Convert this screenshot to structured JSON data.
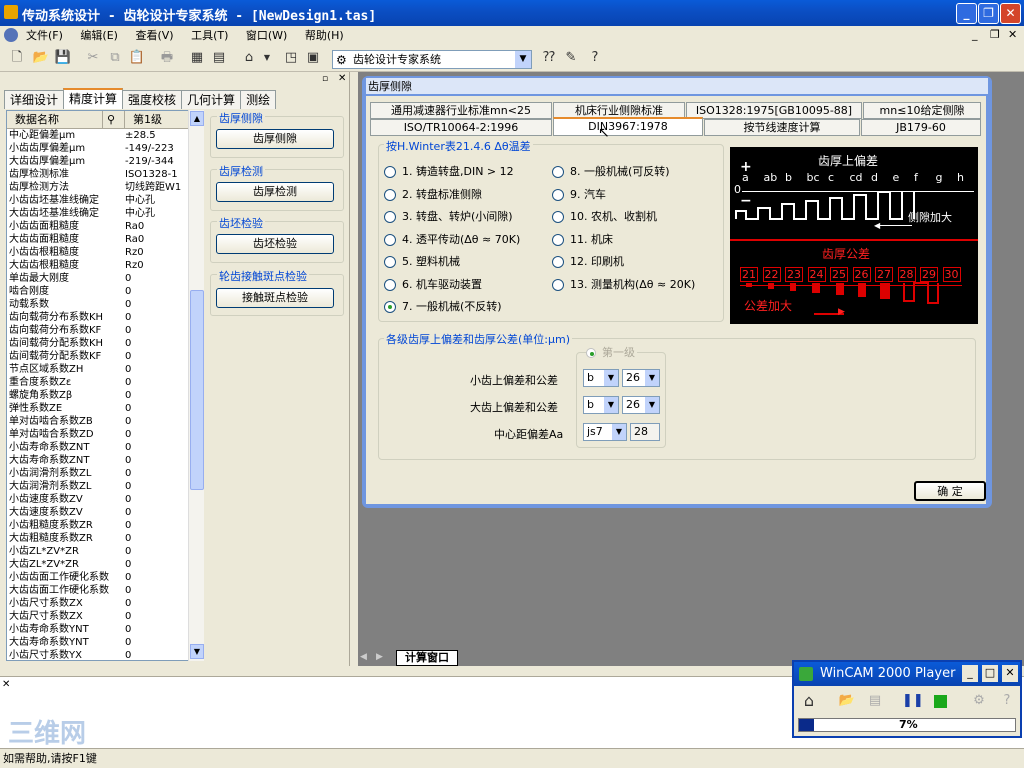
{
  "title": "传动系统设计 - 齿轮设计专家系统 - [NewDesign1.tas]",
  "menu": [
    "文件(F)",
    "编辑(E)",
    "查看(V)",
    "工具(T)",
    "窗口(W)",
    "帮助(H)"
  ],
  "toolbar": {
    "combo_value": "齿轮设计专家系统"
  },
  "left_tabs": [
    "详细设计",
    "精度计算",
    "强度校核",
    "几何计算",
    "测绘"
  ],
  "grid": {
    "headers": [
      "数据名称",
      "第1级"
    ],
    "rows": [
      [
        "中心距偏差μm",
        "±28.5"
      ],
      [
        "小齿齿厚偏差μm",
        "-149/-223"
      ],
      [
        "大齿齿厚偏差μm",
        "-219/-344"
      ],
      [
        "齿厚检测标准",
        "ISO1328-1"
      ],
      [
        "齿厚检测方法",
        "切线跨距W1"
      ],
      [
        "小齿齿坯基准线确定",
        "中心孔"
      ],
      [
        "大齿齿坯基准线确定",
        "中心孔"
      ],
      [
        "小齿齿面粗糙度",
        "Ra0"
      ],
      [
        "大齿齿面粗糙度",
        "Ra0"
      ],
      [
        "小齿齿根粗糙度",
        "Rz0"
      ],
      [
        "大齿齿根粗糙度",
        "Rz0"
      ],
      [
        "单齿最大刚度",
        "0"
      ],
      [
        "啮合刚度",
        "0"
      ],
      [
        "动载系数",
        "0"
      ],
      [
        "齿向载荷分布系数KH",
        "0"
      ],
      [
        "齿向载荷分布系数KF",
        "0"
      ],
      [
        "齿间载荷分配系数KH",
        "0"
      ],
      [
        "齿间载荷分配系数KF",
        "0"
      ],
      [
        "节点区域系数ZH",
        "0"
      ],
      [
        "重合度系数Zε",
        "0"
      ],
      [
        "螺旋角系数Zβ",
        "0"
      ],
      [
        "弹性系数ZE",
        "0"
      ],
      [
        "单对齿啮合系数ZB",
        "0"
      ],
      [
        "单对齿啮合系数ZD",
        "0"
      ],
      [
        "小齿寿命系数ZNT",
        "0"
      ],
      [
        "大齿寿命系数ZNT",
        "0"
      ],
      [
        "小齿润滑剂系数ZL",
        "0"
      ],
      [
        "大齿润滑剂系数ZL",
        "0"
      ],
      [
        "小齿速度系数ZV",
        "0"
      ],
      [
        "大齿速度系数ZV",
        "0"
      ],
      [
        "小齿粗糙度系数ZR",
        "0"
      ],
      [
        "大齿粗糙度系数ZR",
        "0"
      ],
      [
        "小齿ZL*ZV*ZR",
        "0"
      ],
      [
        "大齿ZL*ZV*ZR",
        "0"
      ],
      [
        "小齿齿面工作硬化系数",
        "0"
      ],
      [
        "大齿齿面工作硬化系数",
        "0"
      ],
      [
        "小齿尺寸系数ZX",
        "0"
      ],
      [
        "大齿尺寸系数ZX",
        "0"
      ],
      [
        "小齿寿命系数YNT",
        "0"
      ],
      [
        "大齿寿命系数YNT",
        "0"
      ],
      [
        "小齿尺寸系数YX",
        "0"
      ]
    ]
  },
  "side_groups": [
    {
      "title": "齿厚侧隙",
      "button": "齿厚侧隙"
    },
    {
      "title": "齿厚检测",
      "button": "齿厚检测"
    },
    {
      "title": "齿坯检验",
      "button": "齿坯检验"
    },
    {
      "title": "轮齿接触斑点检验",
      "button": "接触斑点检验"
    }
  ],
  "dialog": {
    "title": "齿厚侧隙",
    "tabs_row1": [
      "通用减速器行业标准mn<25",
      "机床行业侧隙标准",
      "ISO1328:1975[GB10095-88]",
      "mn≤10给定侧隙"
    ],
    "tabs_row2": [
      "ISO/TR10064-2:1996",
      "DIN3967:1978",
      "按节线速度计算",
      "JB179-60"
    ],
    "winter_title": "按H.Winter表21.4.6 Δθ温差",
    "options_left": [
      "1. 铸造转盘,DIN > 12",
      "2. 转盘标准侧隙",
      "3. 转盘、转炉(小间隙)",
      "4. 透平传动(Δθ ≈ 70K)",
      "5. 塑料机械",
      "6. 机车驱动装置",
      "7. 一般机械(不反转)"
    ],
    "options_right": [
      "8. 一般机械(可反转)",
      "9. 汽车",
      "10. 农机、收割机",
      "11. 机床",
      "12. 印刷机",
      "13. 测量机构(Δθ ≈ 20K)"
    ],
    "selected": 7,
    "chart": {
      "upper_title": "齿厚上偏差",
      "upper_letters": [
        "a",
        "ab",
        "b",
        "bc",
        "c",
        "cd",
        "d",
        "e",
        "f",
        "g",
        "h"
      ],
      "upper_plus": "+",
      "upper_zero": "0",
      "upper_minus": "−",
      "upper_caption": "侧隙加大",
      "lower_title": "齿厚公差",
      "lower_numbers": [
        "21",
        "22",
        "23",
        "24",
        "25",
        "26",
        "27",
        "28",
        "29",
        "30"
      ],
      "lower_caption": "公差加大"
    },
    "dev_frame_title": "各级齿厚上偏差和齿厚公差(单位:μm)",
    "level_label": "第一级",
    "small_label": "小齿上偏差和公差",
    "small_dev": "b",
    "small_tol": "26",
    "big_label": "大齿上偏差和公差",
    "big_dev": "b",
    "big_tol": "26",
    "center_label": "中心距偏差Aa",
    "center_val": "js7",
    "center_num": "28",
    "ok": "确  定"
  },
  "bottom_tab": "计算窗口",
  "status": "如需帮助,请按F1键",
  "player": {
    "title": "WinCAM 2000 Player",
    "progress_text": "7%",
    "progress": 0.07
  },
  "watermark": "三维网"
}
